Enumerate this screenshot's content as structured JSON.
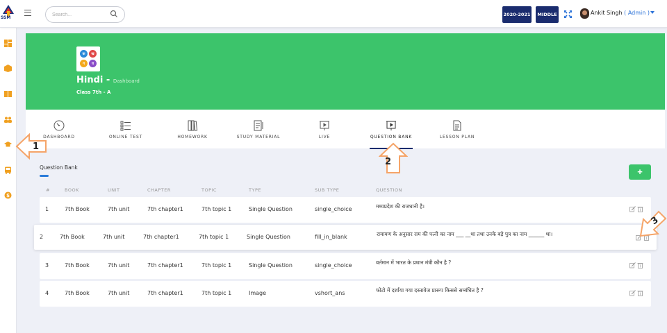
{
  "header": {
    "logo_text": "SSM",
    "search_placeholder": "Search...",
    "session": "2020-2021",
    "level": "MIDDLE",
    "user_name": "Ankit Singh",
    "user_role": "( Admin )"
  },
  "hero": {
    "subject": "Hindi",
    "separator": " - ",
    "crumb": "Dashboard",
    "class_label": "Class 7th - A",
    "logo_letters": [
      "क",
      "ख",
      "ग",
      "घ"
    ]
  },
  "tabs": [
    {
      "label": "DASHBOARD",
      "icon": "gauge-icon"
    },
    {
      "label": "ONLINE TEST",
      "icon": "checklist-icon"
    },
    {
      "label": "HOMEWORK",
      "icon": "books-icon"
    },
    {
      "label": "STUDY MATERIAL",
      "icon": "notebook-icon"
    },
    {
      "label": "LIVE",
      "icon": "presentation-icon"
    },
    {
      "label": "QUESTION BANK",
      "icon": "presentation-icon",
      "active": true
    },
    {
      "label": "LESSON PLAN",
      "icon": "document-icon"
    }
  ],
  "section_title": "Question Bank",
  "add_label": "+",
  "table": {
    "columns": [
      "#",
      "BOOK",
      "UNIT",
      "CHAPTER",
      "TOPIC",
      "TYPE",
      "SUB TYPE",
      "QUESTION"
    ],
    "rows": [
      {
        "num": "1",
        "book": "7th Book",
        "unit": "7th unit",
        "chapter": "7th chapter1",
        "topic": "7th topic 1",
        "type": "Single Question",
        "subtype": "single_choice",
        "question": "मध्यप्रदेश की राजधानी है।"
      },
      {
        "num": "2",
        "book": "7th Book",
        "unit": "7th unit",
        "chapter": "7th chapter1",
        "topic": "7th topic 1",
        "type": "Single Question",
        "subtype": "fill_in_blank",
        "question": "रामायण के अनुसार राम की पत्नी का नाम ___ __था तथा उनके बड़े पुत्र का नाम ______ था।"
      },
      {
        "num": "3",
        "book": "7th Book",
        "unit": "7th unit",
        "chapter": "7th chapter1",
        "topic": "7th topic 1",
        "type": "Single Question",
        "subtype": "single_choice",
        "question": "वर्तमान में भारत के प्रधान मंत्री कौन है ?"
      },
      {
        "num": "4",
        "book": "7th Book",
        "unit": "7th unit",
        "chapter": "7th chapter1",
        "topic": "7th topic 1",
        "type": "Image",
        "subtype": "vshort_ans",
        "question": "फोटो में दर्शाया गया दस्तावेज प्रारूप किससे सम्बंधित है ?"
      }
    ]
  },
  "callouts": [
    "1",
    "2",
    "3"
  ],
  "colors": {
    "primary_green": "#3cc46b",
    "navy": "#1a2c6e",
    "accent_blue": "#2b72d8",
    "sidebar_icon": "#f0a020",
    "callout_orange": "#f5a468"
  }
}
